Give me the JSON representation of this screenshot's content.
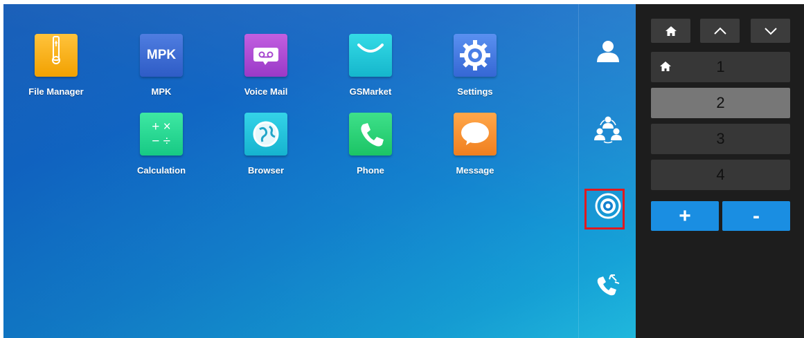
{
  "apps": [
    {
      "name": "File Manager",
      "icon": "file-manager-icon"
    },
    {
      "name": "MPK",
      "icon": "mpk-icon",
      "icon_text": "MPK"
    },
    {
      "name": "Voice Mail",
      "icon": "voicemail-icon"
    },
    {
      "name": "GSMarket",
      "icon": "gsmarket-icon"
    },
    {
      "name": "Settings",
      "icon": "gear-icon"
    },
    {
      "name": "Calculation",
      "icon": "calculator-icon",
      "icon_text": "+ ×\n− ÷"
    },
    {
      "name": "Browser",
      "icon": "globe-icon"
    },
    {
      "name": "Phone",
      "icon": "phone-icon"
    },
    {
      "name": "Message",
      "icon": "message-bubble-icon"
    }
  ],
  "side_buttons": [
    "contact-icon",
    "conference-icon",
    "camera-lens-icon",
    "call-transfer-icon"
  ],
  "panel": {
    "nav": [
      "home-icon",
      "chevron-up-icon",
      "chevron-down-icon"
    ],
    "lines": [
      {
        "label": "1"
      },
      {
        "label": "2"
      },
      {
        "label": "3"
      },
      {
        "label": "4"
      }
    ],
    "add_label": "+",
    "remove_label": "-"
  },
  "colors": {
    "accent": "#1a8ee2",
    "highlight": "#e0191e",
    "panel_bg": "#1d1d1d"
  }
}
